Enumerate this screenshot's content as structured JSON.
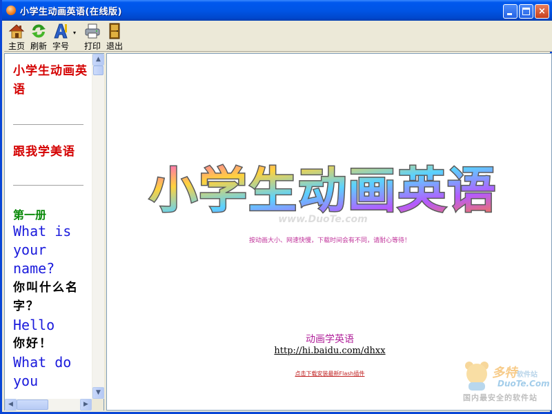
{
  "window": {
    "title": "小学生动画英语(在线版)",
    "controls": {
      "minimize": "minimize",
      "maximize": "maximize",
      "close": "×"
    }
  },
  "toolbar": {
    "items": [
      {
        "label": "主页",
        "icon": "home-icon"
      },
      {
        "label": "刷新",
        "icon": "refresh-icon"
      },
      {
        "label": "字号",
        "icon": "font-size-icon"
      },
      {
        "label": "打印",
        "icon": "printer-icon"
      },
      {
        "label": "退出",
        "icon": "exit-door-icon"
      }
    ],
    "font_dropdown_glyph": "▾"
  },
  "sidebar": {
    "links": [
      {
        "label": "小学生动画英语"
      },
      {
        "label": "跟我学美语"
      }
    ],
    "book": "第一册",
    "lessons": [
      {
        "en": "What is your name?",
        "cn": "你叫什么名字？"
      },
      {
        "en": "Hello",
        "cn": "你好！"
      },
      {
        "en": "What do you"
      }
    ],
    "scroll": {
      "up": "▲",
      "down": "▼",
      "left": "◀",
      "right": "▶"
    }
  },
  "main": {
    "banner_text": "小学生动画英语",
    "banner_watermark": "www.DuoTe.com",
    "notice": "按动画大小、网速快慢，下载时间会有不同，请耐心等待！",
    "site_title": "动画学英语",
    "site_url": "http://hi.baidu.com/dhxx",
    "flash_link": "点击下载安装最新Flash插件"
  },
  "watermark": {
    "brand": "多特",
    "brand_suffix": "软件站",
    "domain": "DuoTe.Com",
    "slogan": "国内最安全的软件站"
  },
  "colors": {
    "titlebar": "#0055e5",
    "sidebar_heading": "#d40000",
    "book_heading": "#0a8a0a",
    "english_text": "#1a1adc",
    "site_title": "#b0209a"
  }
}
